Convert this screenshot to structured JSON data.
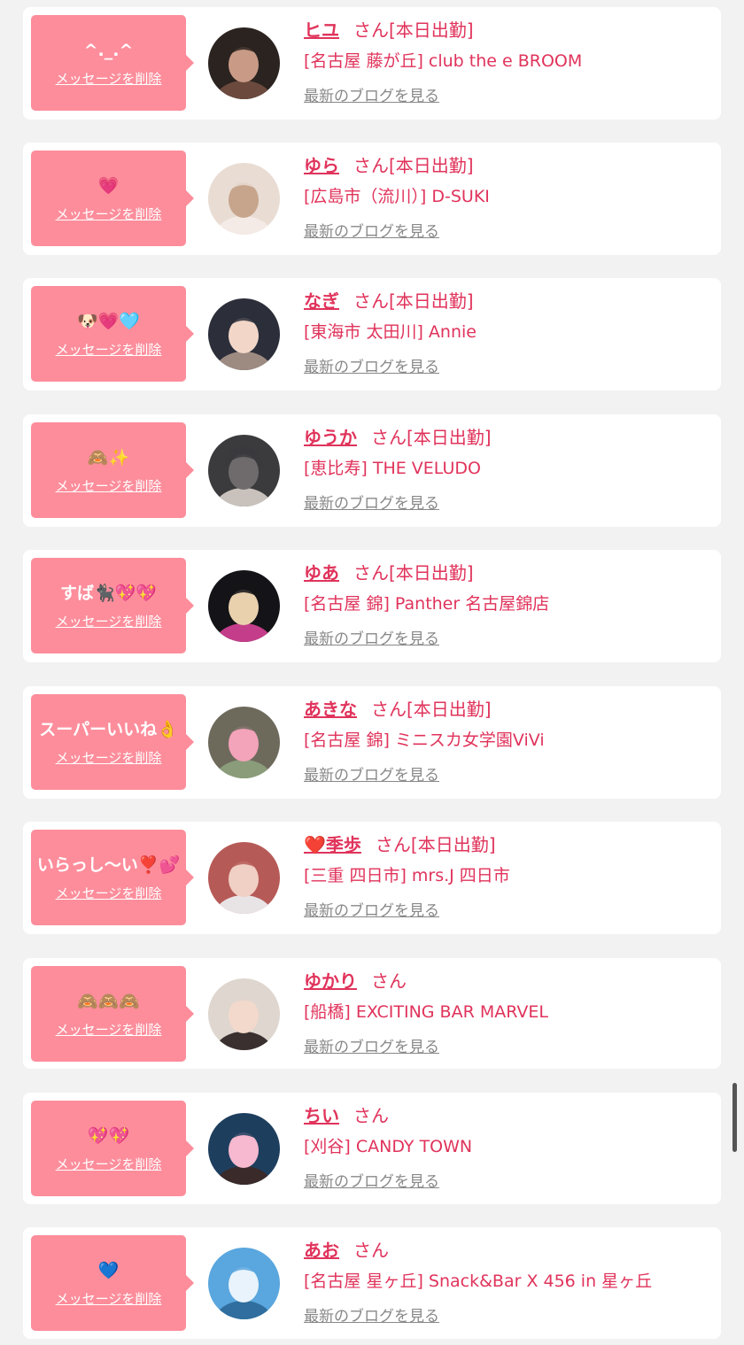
{
  "colors": {
    "bubble": "#fd8d9b",
    "accent": "#e0335b",
    "link_gray": "#888888"
  },
  "labels": {
    "delete": "メッセージを削除",
    "blog": "最新のブログを見る",
    "honorific": "さん"
  },
  "items": [
    {
      "message": "^._.^",
      "name": "ヒユ",
      "status": "[本日出勤]",
      "shop": "[名古屋 藤が丘] club the e BROOM",
      "avatar": "avatar-dark-dog-filter"
    },
    {
      "message": "💗",
      "name": "ゆら",
      "status": "[本日出勤]",
      "shop": "[広島市（流川）] D-SUKI",
      "avatar": "avatar-light-hair"
    },
    {
      "message": "🐶💗🩵",
      "name": "なぎ",
      "status": "[本日出勤]",
      "shop": "[東海市 太田川] Annie",
      "avatar": "avatar-police-cap"
    },
    {
      "message": "🙈✨",
      "name": "ゆうか",
      "status": "[本日出勤]",
      "shop": "[恵比寿] THE VELUDO",
      "avatar": "avatar-dark-hair-back"
    },
    {
      "message": "すば🐈‍⬛💖💖",
      "name": "ゆあ",
      "status": "[本日出勤]",
      "shop": "[名古屋 錦] Panther 名古屋錦店",
      "avatar": "avatar-blonde-dark-bg"
    },
    {
      "message": "スーパーいいね👌",
      "name": "あきな",
      "status": "[本日出勤]",
      "shop": "[名古屋 錦] ミニスカ女学園ViVi",
      "avatar": "avatar-heart-sticker"
    },
    {
      "message": "いらっし〜い❣️💕",
      "name": "❤️季歩",
      "status": "[本日出勤]",
      "shop": "[三重 四日市] mrs.J 四日市",
      "avatar": "avatar-red-hair"
    },
    {
      "message": "🙈🙈🙈",
      "name": "ゆかり",
      "status": "",
      "shop": "[船橋] EXCITING BAR MARVEL",
      "avatar": "avatar-light-face"
    },
    {
      "message": "💖💖",
      "name": "ちい",
      "status": "",
      "shop": "[刈谷] CANDY TOWN",
      "avatar": "avatar-pink-mask"
    },
    {
      "message": "💙",
      "name": "あお",
      "status": "",
      "shop": "[名古屋 星ヶ丘] Snack&Bar X 456 in 星ヶ丘",
      "avatar": "avatar-sky"
    }
  ]
}
